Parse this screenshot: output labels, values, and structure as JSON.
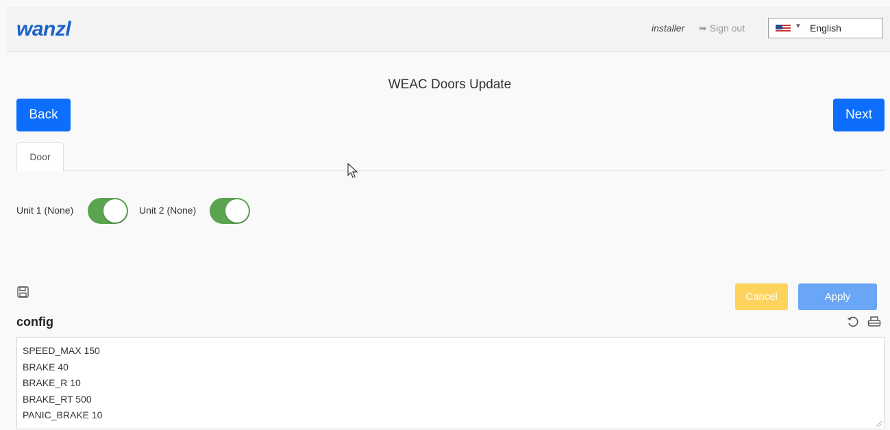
{
  "header": {
    "logo": "wanzl",
    "user": "installer",
    "signout_label": "Sign out",
    "language": {
      "selected": "English",
      "flag_icon": "us-flag-icon"
    }
  },
  "page": {
    "title": "WEAC Doors Update"
  },
  "nav": {
    "back_label": "Back",
    "next_label": "Next"
  },
  "tabs": [
    {
      "label": "Door"
    }
  ],
  "units": [
    {
      "label": "Unit 1 (None)",
      "enabled": true
    },
    {
      "label": "Unit 2 (None)",
      "enabled": true
    }
  ],
  "actions": {
    "cancel_label": "Cancel",
    "apply_label": "Apply"
  },
  "config": {
    "label": "config",
    "lines": [
      "SPEED_MAX 150",
      "BRAKE 40",
      "BRAKE_R 10",
      "BRAKE_RT 500",
      "PANIC_BRAKE 10"
    ]
  },
  "colors": {
    "primary": "#0d6efd",
    "toggle_on": "#5aa34f",
    "cancel": "#fdd35e",
    "apply": "#69a6f5",
    "logo": "#1b63c6"
  }
}
